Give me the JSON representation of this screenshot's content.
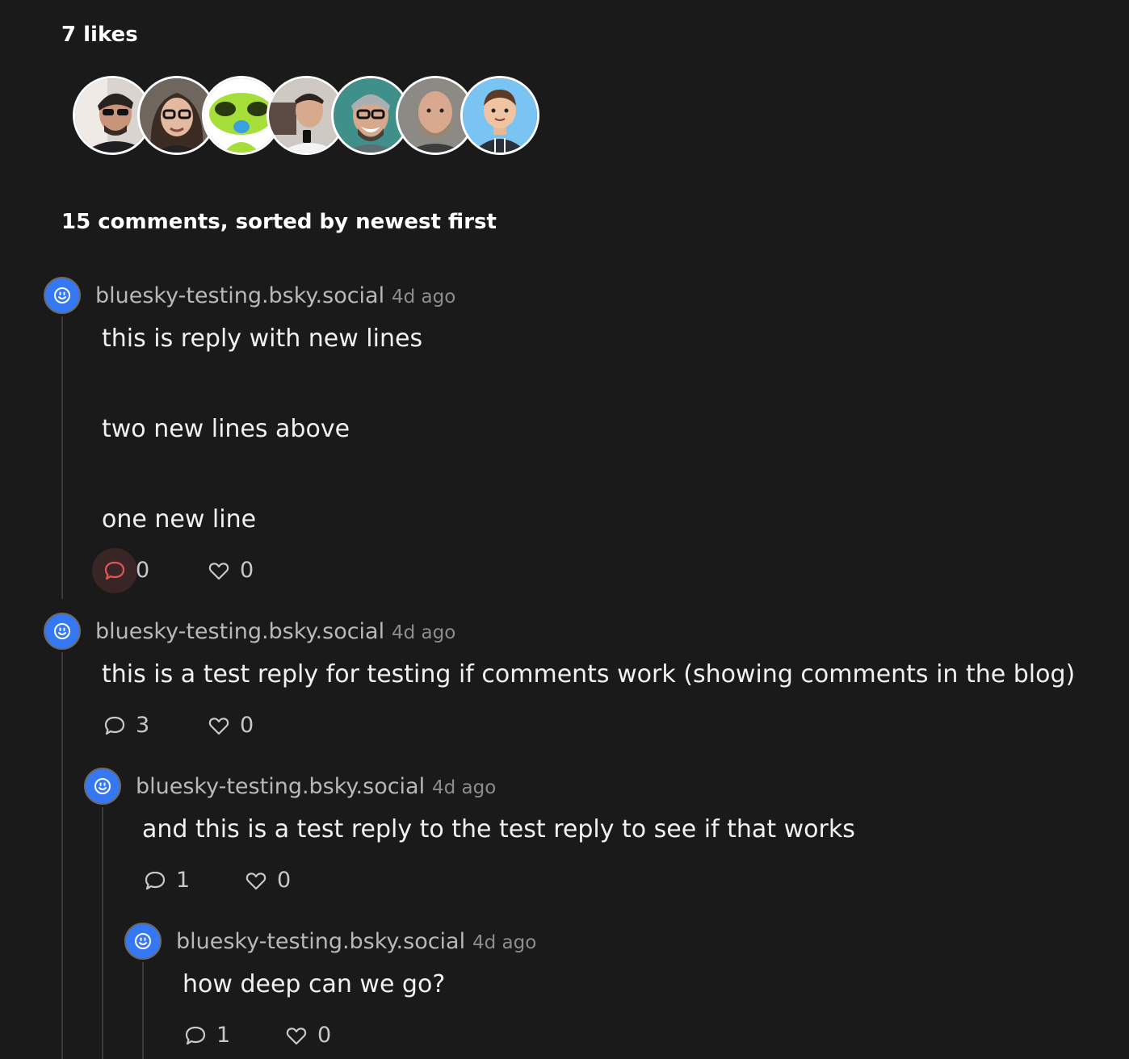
{
  "likes": {
    "title": "7 likes",
    "avatars": [
      {
        "icon": "person-sunglasses-avatar-icon"
      },
      {
        "icon": "person-glasses-woman-avatar-icon"
      },
      {
        "icon": "green-alien-avatar-icon"
      },
      {
        "icon": "person-selfie-avatar-icon"
      },
      {
        "icon": "person-smiling-glasses-avatar-icon"
      },
      {
        "icon": "person-bald-beard-avatar-icon"
      },
      {
        "icon": "cartoon-person-avatar-icon"
      }
    ]
  },
  "comments_title": "15 comments, sorted by newest first",
  "comments": [
    {
      "author": "bluesky-testing.bsky.social",
      "time": "4d ago",
      "lines": [
        "this is reply with new lines",
        "two new lines above",
        "one new line"
      ],
      "replies": "0",
      "likes": "0"
    },
    {
      "author": "bluesky-testing.bsky.social",
      "time": "4d ago",
      "lines": [
        "this is a test reply for testing if comments work (showing comments in the blog)"
      ],
      "replies": "3",
      "likes": "0"
    },
    {
      "author": "bluesky-testing.bsky.social",
      "time": "4d ago",
      "lines": [
        "and this is a test reply to the test reply to see if that works"
      ],
      "replies": "1",
      "likes": "0"
    },
    {
      "author": "bluesky-testing.bsky.social",
      "time": "4d ago",
      "lines": [
        "how deep can we go?"
      ],
      "replies": "1",
      "likes": "0"
    }
  ],
  "colors": {
    "background": "#1b1a1a",
    "avatar_blue": "#3478f6",
    "reply_highlight": "#e0555a"
  }
}
